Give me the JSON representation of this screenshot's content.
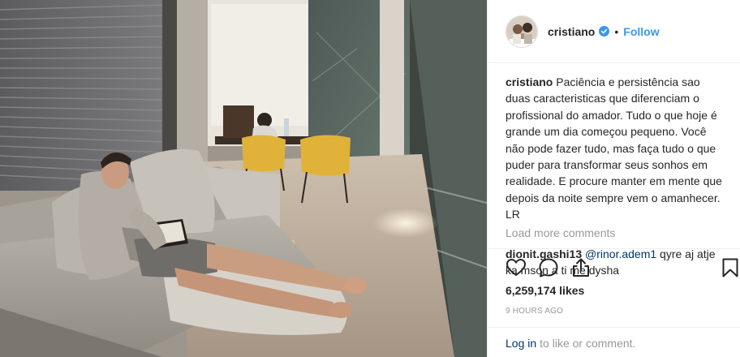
{
  "post": {
    "username": "cristiano",
    "header_separator": "•",
    "follow_label": "Follow",
    "caption_username": "cristiano",
    "caption": "Paciência e persistência sao duas caracteristicas que diferenciam o profissional do amador. Tudo o que hoje é grande um dia começou pequeno. Você não pode fazer tudo, mas faça tudo o que puder para transformar seus sonhos em realidade. E procure manter em mente que depois da noite sempre vem o amanhecer. LR",
    "load_more": "Load more comments",
    "comment": {
      "username": "dionit.gashi13",
      "mention": "@rinor.adem1",
      "text": " qyre aj atje ka mson a ti me dysha"
    },
    "likes": "6,259,174 likes",
    "time": "9 HOURS AGO",
    "login_link": "Log in",
    "login_suffix": "to like or comment."
  },
  "icons": {
    "like": "heart-icon",
    "comment": "comment-icon",
    "share": "share-icon",
    "save": "bookmark-icon",
    "verified": "verified-badge-icon"
  },
  "colors": {
    "accent": "#3897f0",
    "link": "#003569",
    "muted": "#999999",
    "text": "#262626",
    "divider": "#efefef"
  }
}
